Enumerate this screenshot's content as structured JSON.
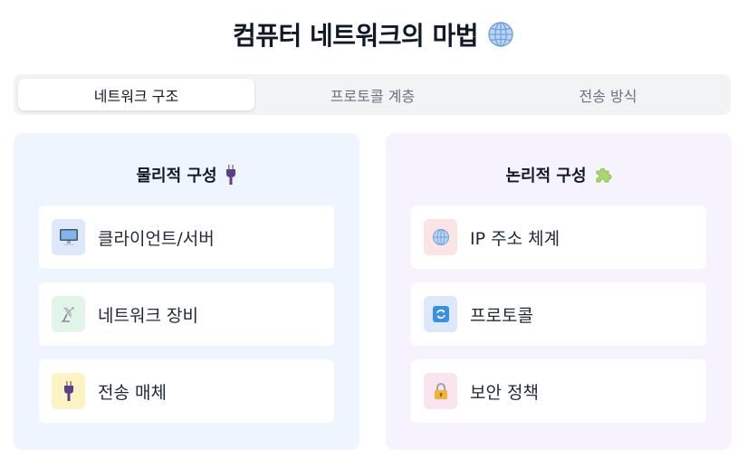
{
  "title": {
    "text": "컴퓨터 네트워크의 마법",
    "icon": "globe-icon"
  },
  "tabs": [
    {
      "label": "네트워크 구조",
      "active": true
    },
    {
      "label": "프로토콜 계층",
      "active": false
    },
    {
      "label": "전송 방식",
      "active": false
    }
  ],
  "panels": {
    "physical": {
      "title": "물리적 구성",
      "icon": "plug-icon",
      "items": [
        {
          "label": "클라이언트/서버",
          "icon": "desktop-computer-icon",
          "icon_bg": "#dde8fb"
        },
        {
          "label": "네트워크 장비",
          "icon": "satellite-antenna-icon",
          "icon_bg": "#e1f6e9"
        },
        {
          "label": "전송 매체",
          "icon": "plug-icon",
          "icon_bg": "#fbf4c2"
        }
      ]
    },
    "logical": {
      "title": "논리적 구성",
      "icon": "puzzle-piece-icon",
      "items": [
        {
          "label": "IP 주소 체계",
          "icon": "globe-icon",
          "icon_bg": "#fbe4e4"
        },
        {
          "label": "프로토콜",
          "icon": "refresh-icon",
          "icon_bg": "#dde8fb"
        },
        {
          "label": "보안 정책",
          "icon": "lock-icon",
          "icon_bg": "#f8e5ef"
        }
      ]
    }
  }
}
